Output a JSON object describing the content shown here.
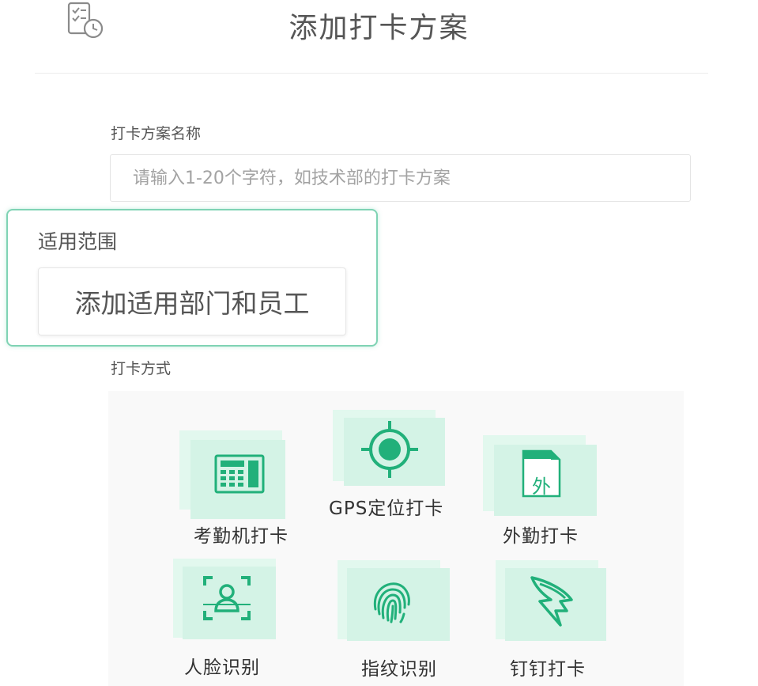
{
  "header": {
    "icon": "checklist-clock-icon",
    "title": "添加打卡方案"
  },
  "name_field": {
    "label": "打卡方案名称",
    "placeholder": "请输入1-20个字符，如技术部的打卡方案",
    "value": ""
  },
  "scope": {
    "title": "适用范围",
    "button_label": "添加适用部门和员工"
  },
  "methods": {
    "label": "打卡方式",
    "items": [
      {
        "label": "考勤机打卡",
        "icon": "attendance-machine-icon"
      },
      {
        "label": "GPS定位打卡",
        "icon": "gps-target-icon"
      },
      {
        "label": "外勤打卡",
        "icon": "field-document-icon"
      },
      {
        "label": "人脸识别",
        "icon": "face-scan-icon"
      },
      {
        "label": "指纹识别",
        "icon": "fingerprint-icon"
      },
      {
        "label": "钉钉打卡",
        "icon": "dingtalk-wing-icon"
      }
    ],
    "icon_badge_char": "外"
  },
  "colors": {
    "accent": "#21b07a",
    "tile": "#d4f3e6",
    "border_highlight": "#7fd3b4"
  }
}
